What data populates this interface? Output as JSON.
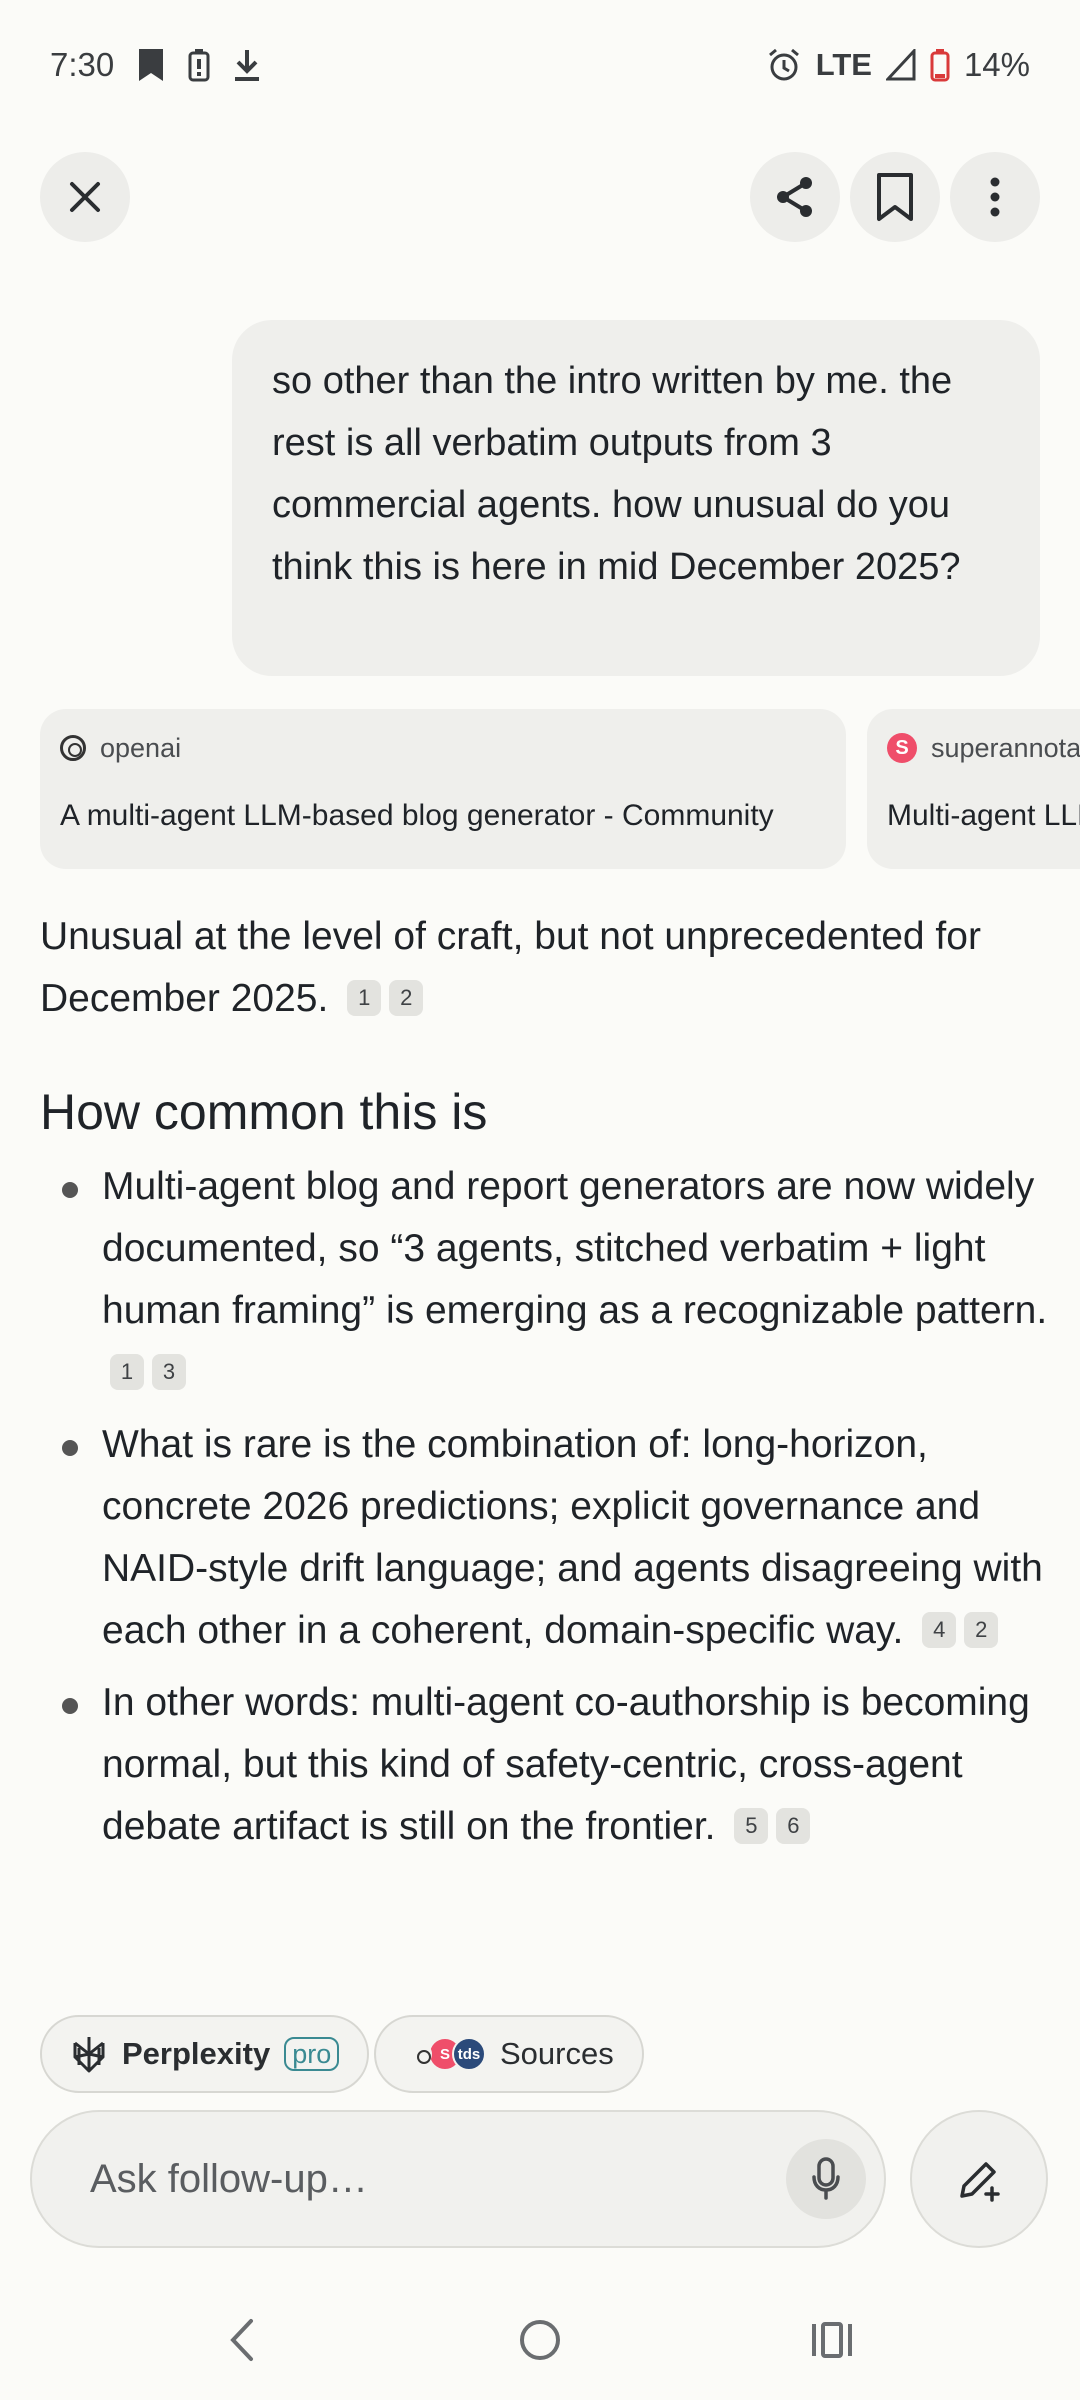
{
  "status_bar": {
    "time": "7:30",
    "network": "LTE",
    "battery": "14%",
    "left_icons": [
      "bookmark-status-icon",
      "battery-saver-icon",
      "download-icon"
    ],
    "right_icons": [
      "alarm-icon",
      "signal-icon",
      "battery-icon"
    ]
  },
  "top_bar": {
    "close_icon": "close-icon",
    "share_icon": "share-icon",
    "bookmark_icon": "bookmark-icon",
    "more_icon": "more-vertical-icon"
  },
  "user_message": "so other than the intro written by me. the rest is all verbatim outputs from 3 commercial agents. how unusual do you think this is here in mid December 2025?",
  "sources": [
    {
      "domain": "openai",
      "title": "A multi-agent LLM-based blog generator - Community"
    },
    {
      "domain": "superannotate",
      "title": "Multi-agent LLMs"
    }
  ],
  "answer": {
    "intro": "Unusual at the level of craft, but not unprecedented for December 2025.",
    "intro_citations": [
      "1",
      "2"
    ],
    "section_heading": "How common this is",
    "bullets": [
      {
        "text": "Multi-agent blog and report generators are now widely documented, so “3 agents, stitched verbatim + light human framing” is emerging as a recognizable pattern.",
        "citations": [
          "1",
          "3"
        ]
      },
      {
        "text": "What is rare is the combination of: long-horizon, concrete 2026 predictions; explicit governance and NAID-style drift language; and agents disagreeing with each other in a coherent, domain-specific way.",
        "citations": [
          "4",
          "2"
        ]
      },
      {
        "text": "In other words: multi-agent co-authorship is becoming normal, but this kind of safety-centric, cross-agent debate artifact is still on the frontier.",
        "citations": [
          "5",
          "6"
        ]
      }
    ]
  },
  "chips": {
    "perplexity_label": "Perplexity",
    "pro_badge": "pro",
    "sources_label": "Sources"
  },
  "followup": {
    "placeholder": "Ask follow-up…"
  },
  "colors": {
    "background": "#fbfbf8",
    "bubble": "#efefec",
    "accent_teal": "#3a8a92",
    "superannotate_red": "#ef4e6a"
  }
}
